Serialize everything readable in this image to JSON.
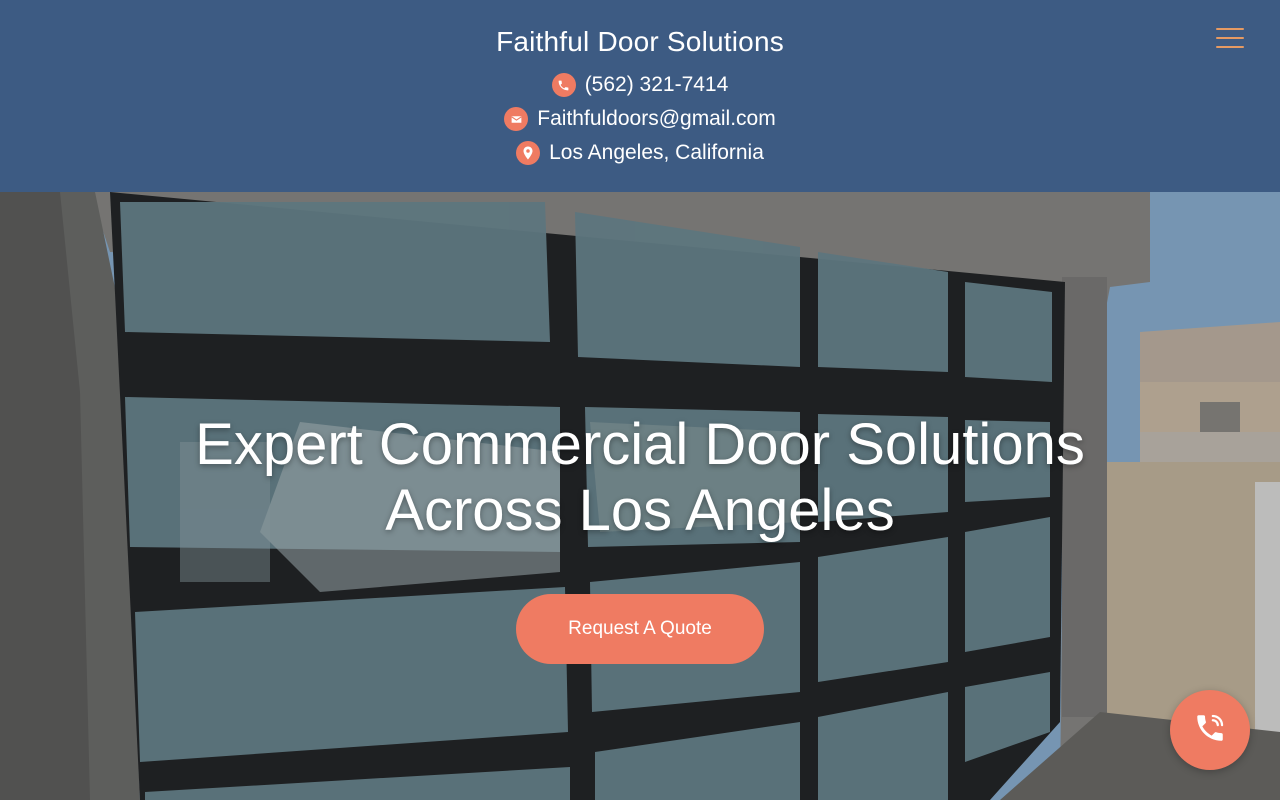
{
  "header": {
    "brand": "Faithful Door Solutions",
    "contacts": [
      {
        "icon": "phone-icon",
        "text": "(562) 321-7414"
      },
      {
        "icon": "email-icon",
        "text": "Faithfuldoors@gmail.com"
      },
      {
        "icon": "location-pin-icon",
        "text": "Los Angeles, California"
      }
    ],
    "menu_icon": "hamburger-menu-icon",
    "background_color": "#3d5b83",
    "accent_color": "#ef7b62",
    "menu_icon_color": "#e59a63"
  },
  "hero": {
    "title_line1": "Expert Commercial Door Solutions",
    "title_line2": "Across Los Angeles",
    "cta_label": "Request A Quote",
    "image_subject": "glass-panel garage door with dark frame"
  },
  "floating": {
    "call_icon": "phone-call-icon"
  }
}
